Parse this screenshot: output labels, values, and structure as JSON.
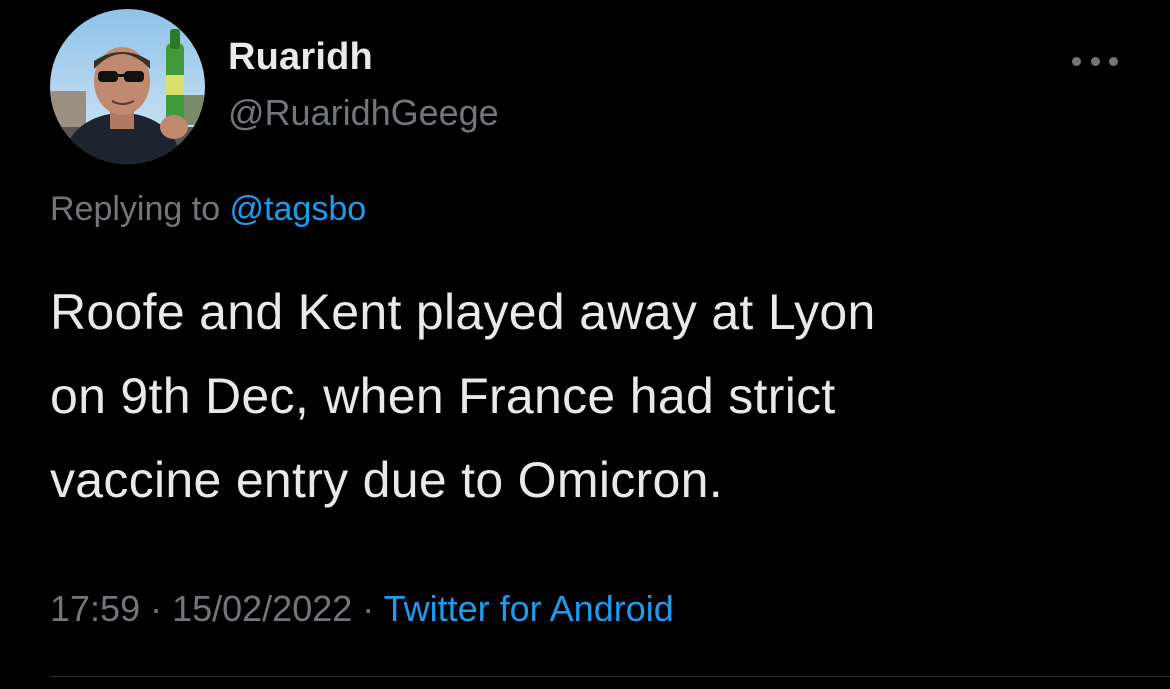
{
  "author": {
    "display_name": "Ruaridh",
    "handle": "@RuaridhGeege"
  },
  "reply": {
    "prefix": "Replying to ",
    "mention": "@tagsbo"
  },
  "tweet": {
    "lines": [
      "Roofe and Kent played away at Lyon",
      "on 9th Dec, when France had strict",
      "vaccine entry due to Omicron."
    ]
  },
  "meta": {
    "time": "17:59",
    "separator": " · ",
    "date": "15/02/2022",
    "source": "Twitter for Android"
  },
  "icons": {
    "more": "more-horizontal-icon"
  },
  "colors": {
    "background": "#000000",
    "text": "#e7e9ea",
    "secondary": "#71767b",
    "accent": "#1d9bf0"
  }
}
